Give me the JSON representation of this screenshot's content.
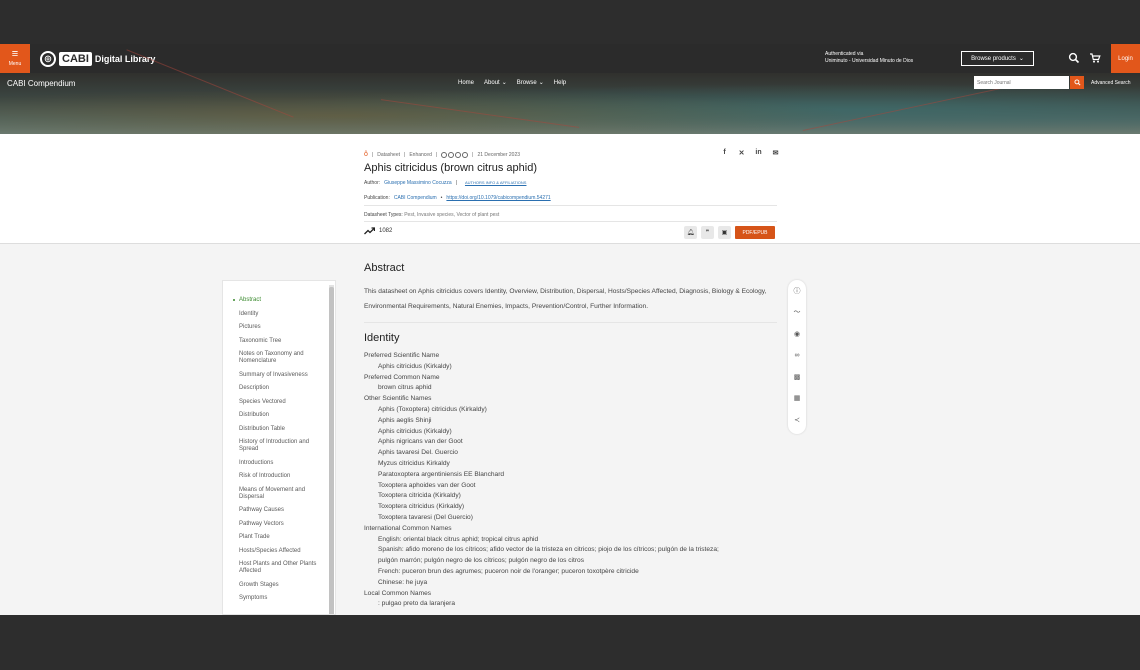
{
  "header": {
    "menu_label": "Menu",
    "logo_text": "CABI",
    "logo_suffix": "Digital Library",
    "auth_line1": "Authenticated via",
    "auth_line2": "Uniminuto - Universidad Minuto de Dios",
    "browse_label": "Browse products",
    "login_label": "Login"
  },
  "banner": {
    "title": "CABI Compendium",
    "nav": [
      "Home",
      "About",
      "Browse",
      "Help"
    ],
    "search_placeholder": "Search Journal",
    "advanced_search": "Advanced Search"
  },
  "article": {
    "meta": {
      "type": "Datasheet",
      "status": "Enhanced",
      "date": "21 December 2023"
    },
    "title": "Aphis citricidus (brown citrus aphid)",
    "author_label": "Author:",
    "author": "Giuseppe Massimino Cocuzza",
    "affiliations": "AUTHORS INFO & AFFILIATIONS",
    "publication_label": "Publication:",
    "publication": "CABI Compendium",
    "doi": "https://doi.org/10.1079/cabicompendium.54271",
    "types_label": "Datasheet Types:",
    "types": "Pest, Invasive species, Vector of plant pest",
    "metric_count": "1082",
    "pdf_label": "PDF/EPUB"
  },
  "toc": {
    "items": [
      "Abstract",
      "Identity",
      "Pictures",
      "Taxonomic Tree",
      "Notes on Taxonomy and Nomenclature",
      "Summary of Invasiveness",
      "Description",
      "Species Vectored",
      "Distribution",
      "Distribution Table",
      "History of Introduction and Spread",
      "Introductions",
      "Risk of Introduction",
      "Means of Movement and Dispersal",
      "Pathway Causes",
      "Pathway Vectors",
      "Plant Trade",
      "Hosts/Species Affected",
      "Host Plants and Other Plants Affected",
      "Growth Stages",
      "Symptoms"
    ]
  },
  "content": {
    "abstract_heading": "Abstract",
    "abstract_text": "This datasheet on Aphis citricidus covers Identity, Overview, Distribution, Dispersal, Hosts/Species Affected, Diagnosis, Biology & Ecology, Environmental Requirements, Natural Enemies, Impacts, Prevention/Control, Further Information.",
    "identity_heading": "Identity",
    "identity_lines": [
      {
        "level": 1,
        "text": "Preferred Scientific Name"
      },
      {
        "level": 2,
        "text": "Aphis citricidus (Kirkaldy)"
      },
      {
        "level": 1,
        "text": "Preferred Common Name"
      },
      {
        "level": 2,
        "text": "brown citrus aphid"
      },
      {
        "level": 1,
        "text": "Other Scientific Names"
      },
      {
        "level": 2,
        "text": "Aphis (Toxoptera) citricidus (Kirkaldy)"
      },
      {
        "level": 2,
        "text": "Aphis aeglis Shinji"
      },
      {
        "level": 2,
        "text": "Aphis citricidus (Kirkaldy)"
      },
      {
        "level": 2,
        "text": "Aphis nigricans van der Goot"
      },
      {
        "level": 2,
        "text": "Aphis tavaresi Del. Guercio"
      },
      {
        "level": 2,
        "text": "Myzus citricidus Kirkaldy"
      },
      {
        "level": 2,
        "text": "Paratoxoptera argentiniensis EE Blanchard"
      },
      {
        "level": 2,
        "text": "Toxoptera aphoides van der Goot"
      },
      {
        "level": 2,
        "text": "Toxoptera citricida (Kirkaldy)"
      },
      {
        "level": 2,
        "text": "Toxoptera citricidus (Kirkaldy)"
      },
      {
        "level": 2,
        "text": "Toxoptera tavaresi (Del Guercio)"
      },
      {
        "level": 1,
        "text": "International Common Names"
      },
      {
        "level": 2,
        "text": "English: oriental black citrus aphid; tropical citrus aphid"
      },
      {
        "level": 2,
        "text": "Spanish: afido moreno de los cítricos; afido vector de la tristeza en citricos; piojo de los cítricos; pulgón de la tristeza;"
      },
      {
        "level": 2,
        "text": "pulgón marrón; pulgón negro de los cítricos; pulgón negro de los citros"
      },
      {
        "level": 2,
        "text": "French: puceron brun des agrumes; puceron noir de l'oranger; puceron toxotpère citricide"
      },
      {
        "level": 2,
        "text": "Chinese: he juya"
      },
      {
        "level": 1,
        "text": "Local Common Names"
      },
      {
        "level": 2,
        "text": ": pulgao preto da laranjera"
      }
    ]
  }
}
